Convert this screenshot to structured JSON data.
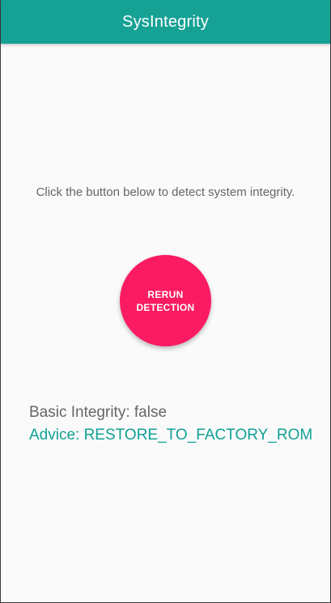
{
  "app_bar": {
    "title": "SysIntegrity"
  },
  "main": {
    "instruction": "Click the button below to detect system integrity.",
    "rerun_button_label": "RERUN DETECTION",
    "basic_integrity_text": "Basic Integrity: false",
    "advice_text": "Advice: RESTORE_TO_FACTORY_ROM"
  },
  "colors": {
    "app_bar": "#16a195",
    "button": "#fb1b63",
    "advice_text": "#11a195",
    "body_text": "#666666"
  }
}
